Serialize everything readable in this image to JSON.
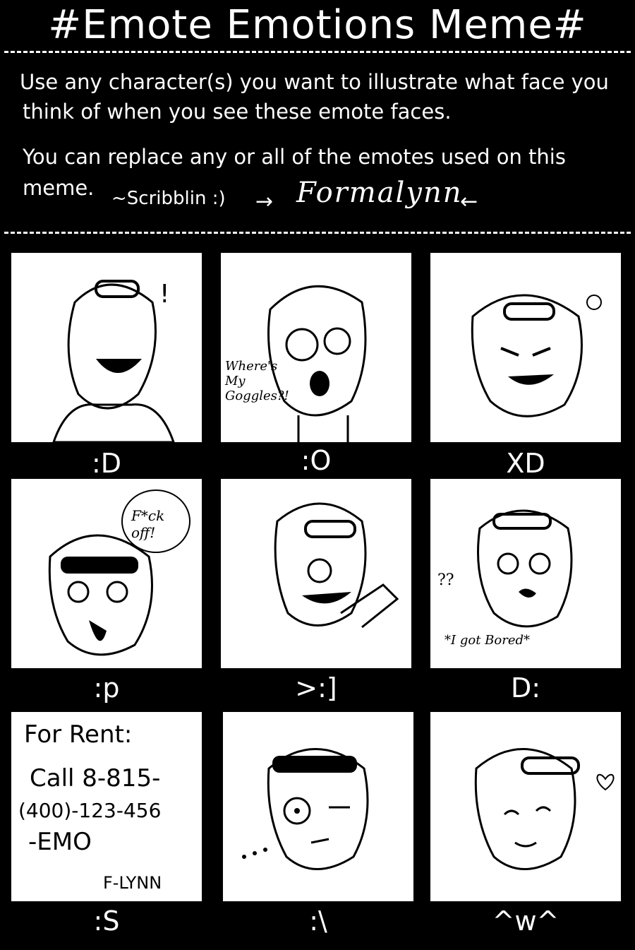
{
  "title": "#Emote Emotions Meme#",
  "intro": {
    "line1": "Use any character(s) you want to illustrate what face you",
    "line2": "think of when you see these emote faces.",
    "line3": "You can replace any or all of the emotes used on this",
    "line4": "meme.",
    "credit": "~Scribblin :)",
    "signature": "Formalynn"
  },
  "panels": [
    {
      "label": ":D"
    },
    {
      "label": ":O",
      "note": "Where's My Goggles?!"
    },
    {
      "label": "XD"
    },
    {
      "label": ":p",
      "note": "F*ck off!"
    },
    {
      "label": ">:]"
    },
    {
      "label": "D:",
      "note": "*I got Bored*"
    },
    {
      "label": ":S",
      "note_lines": [
        "For Rent:",
        "Call 8-815-",
        "(400)-123-456",
        "-EMO",
        "F-LYNN"
      ]
    },
    {
      "label": ":\\"
    },
    {
      "label": "^w^"
    }
  ]
}
